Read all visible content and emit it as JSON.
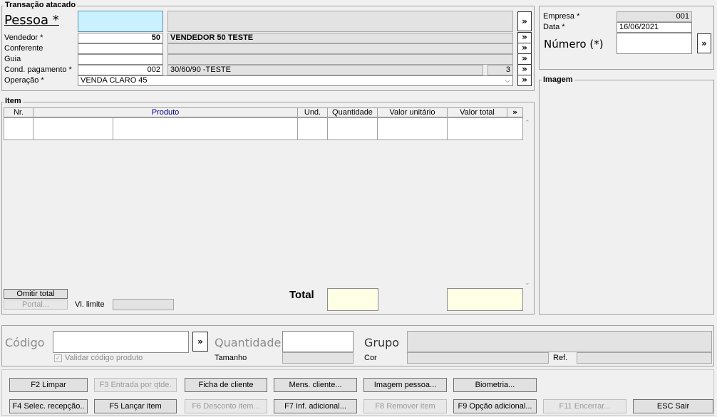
{
  "transacao": {
    "title": "Transação atacado",
    "pessoa_label": "Pessoa *",
    "vendedor": {
      "label": "Vendedor *",
      "code": "50",
      "name": "VENDEDOR 50 TESTE"
    },
    "conferente": {
      "label": "Conferente"
    },
    "guia": {
      "label": "Guia"
    },
    "cond_pagamento": {
      "label": "Cond. pagamento *",
      "code": "002",
      "desc": "30/60/90 -TESTE",
      "parcelas": "3"
    },
    "operacao": {
      "label": "Operação *",
      "value": "VENDA CLARO 45"
    },
    "arrow": "»"
  },
  "empresa": {
    "empresa_label": "Empresa *",
    "empresa_value": "001",
    "data_label": "Data *",
    "data_value": "16/06/2021",
    "numero_label": "Número (*)"
  },
  "imagem": {
    "title": "Imagem"
  },
  "item": {
    "title": "Item",
    "columns": [
      "Nr.",
      "Produto",
      "Und.",
      "Quantidade",
      "Valor unitário",
      "Valor total"
    ],
    "more": "»",
    "omitir_total": "Omitir total",
    "portal": "Portal...",
    "vl_limite_label": "Vl. limite",
    "total_label": "Total"
  },
  "entry": {
    "codigo_label": "Código",
    "validar_label": "Validar código produto",
    "quantidade_label": "Quantidade",
    "tamanho_label": "Tamanho",
    "grupo_label": "Grupo",
    "cor_label": "Cor",
    "ref_label": "Ref."
  },
  "buttons_row1": [
    "F2 Limpar",
    "F3 Entrada por qtde.",
    "Ficha de cliente",
    "Mens. cliente...",
    "Imagem pessoa...",
    "Biometria..."
  ],
  "buttons_row2": [
    "F4 Selec. recepção..",
    "F5 Lançar item",
    "F6 Desconto item...",
    "F7 Inf. adicional...",
    "F8 Remover item",
    "F9 Opção adicional...",
    "F11 Encerrar...",
    "ESC Sair"
  ]
}
